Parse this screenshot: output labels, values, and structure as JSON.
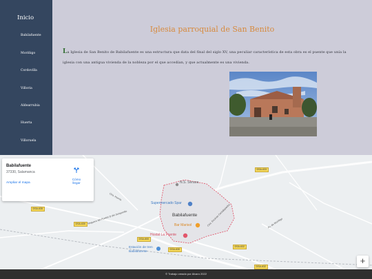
{
  "sidebar": {
    "home": "Inicio",
    "items": [
      "Babilafuente",
      "Moriñigo",
      "Cordovilla",
      "Villoria",
      "Aldearrubia",
      "Huerta",
      "Villoruela"
    ]
  },
  "main": {
    "title": "Iglesia parroquial de San Benito",
    "dropcap": "L",
    "paragraph": "a Iglesia de San Benito de Babilafuente es una estructura que data del final del siglo XV, una peculiar característica de esta obra es el puente que unía la iglesia con una antigua vivienda de la nobleza por el que accedían, y que actualmente es una vivienda."
  },
  "map": {
    "place_name": "Babilafuente",
    "place_address": "37330, Salamanca",
    "enlarge_link": "Ampliar el mapa",
    "directions_label": "Cómo llegar",
    "zoom_in": "+",
    "labels": {
      "town": "Babilafuente",
      "supermarket": "Supermercado Spar",
      "bar": "Bar Marisol",
      "hostal": "Hostal La Fuente",
      "station_line1": "Estación de tren",
      "station_line2": "Babilafuente",
      "ns_senara": "N.S. Senara",
      "road_huerta": "Ctra. Huerta",
      "road_encinas": "Ctra. Encinas Cantalapiedra",
      "road_moriñigo": "Av. de Moriñigo",
      "road_pueblo": "Reguero del Pueblo D del Junquerillo",
      "road_moriñigo2": "Av. de Moriñigo"
    },
    "badges": {
      "b1": "DSA-633",
      "b2": "DSA-635",
      "b3": "DSA-630",
      "b4": "DSA-600",
      "b5": "DSA-630",
      "b6": "DSA-632",
      "b7": "DSA-632",
      "b8": "DSA-632",
      "b9": "DSA-633"
    }
  },
  "footer": {
    "text": "© Trabajo creado por Alvaro 2022"
  },
  "colors": {
    "sidebar_bg": "#34465f",
    "content_bg": "#cdccd9",
    "title": "#d78a3d",
    "footer_bg": "#2f2f2f",
    "link": "#1a73e8"
  }
}
